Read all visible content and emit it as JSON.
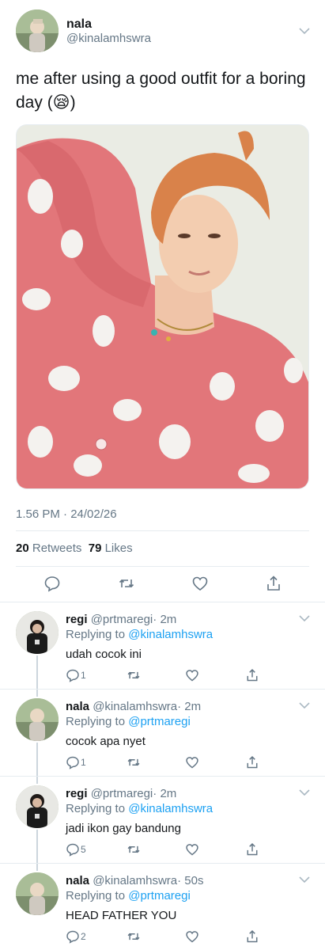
{
  "main_tweet": {
    "author_name": "nala",
    "author_handle": "@kinalamhswra",
    "text": "me after using a good outfit for a boring day (😪)",
    "timestamp": "1.56 PM · 24/02/26",
    "retweets_count": "20",
    "retweets_label": "Retweets",
    "likes_count": "79",
    "likes_label": "Likes",
    "actions": [
      "reply-icon",
      "retweet-icon",
      "like-icon",
      "share-icon"
    ]
  },
  "replies": [
    {
      "name": "regi",
      "handle": "@prtmaregi",
      "time": "· 2m",
      "replying_label": "Replying to",
      "replying_to": "@kinalamhswra",
      "text": "udah cocok ini",
      "reply_count": "1"
    },
    {
      "name": "nala",
      "handle": "@kinalamhswra",
      "time": "· 2m",
      "replying_label": "Replying to",
      "replying_to": "@prtmaregi",
      "text": "cocok apa nyet",
      "reply_count": "1"
    },
    {
      "name": "regi",
      "handle": "@prtmaregi",
      "time": "· 2m",
      "replying_label": "Replying to",
      "replying_to": "@kinalamhswra",
      "text": "jadi ikon gay bandung",
      "reply_count": "5"
    },
    {
      "name": "nala",
      "handle": "@kinalamhswra",
      "time": "· 50s",
      "replying_label": "Replying to",
      "replying_to": "@prtmaregi",
      "text": "HEAD FATHER YOU",
      "reply_count": "2"
    }
  ],
  "colors": {
    "link": "#1da1f2",
    "secondary_text": "#657786",
    "primary_text": "#14171a",
    "divider": "#e6ecf0"
  }
}
